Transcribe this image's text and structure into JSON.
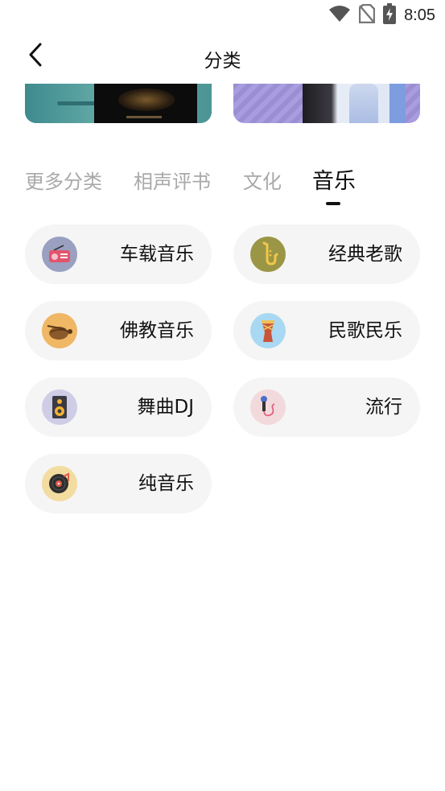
{
  "status_bar": {
    "time": "8:05",
    "icons": [
      "wifi-icon",
      "no-sim-icon",
      "battery-charging-icon"
    ]
  },
  "header": {
    "title": "分类",
    "back_icon": "chevron-left-icon"
  },
  "tabs": [
    {
      "label": "更多分类",
      "active": false
    },
    {
      "label": "相声评书",
      "active": false
    },
    {
      "label": "文化",
      "active": false
    },
    {
      "label": "音乐",
      "active": true
    }
  ],
  "categories": [
    {
      "label": "车载音乐",
      "icon": "radio-icon",
      "icon_bg": "#9aa0c0"
    },
    {
      "label": "经典老歌",
      "icon": "saxophone-icon",
      "icon_bg": "#9b9646"
    },
    {
      "label": "佛教音乐",
      "icon": "muyu-icon",
      "icon_bg": "#f0b765"
    },
    {
      "label": "民歌民乐",
      "icon": "drum-icon",
      "icon_bg": "#a9d9f2"
    },
    {
      "label": "舞曲DJ",
      "icon": "speaker-icon",
      "icon_bg": "#cfcde6"
    },
    {
      "label": "流行",
      "icon": "microphone-icon",
      "icon_bg": "#f2d9dc"
    },
    {
      "label": "纯音乐",
      "icon": "vinyl-record-icon",
      "icon_bg": "#f3dca0"
    }
  ],
  "colors": {
    "pill_bg": "#f5f5f5",
    "tab_inactive": "#a9a9a9",
    "tab_active": "#111111"
  }
}
